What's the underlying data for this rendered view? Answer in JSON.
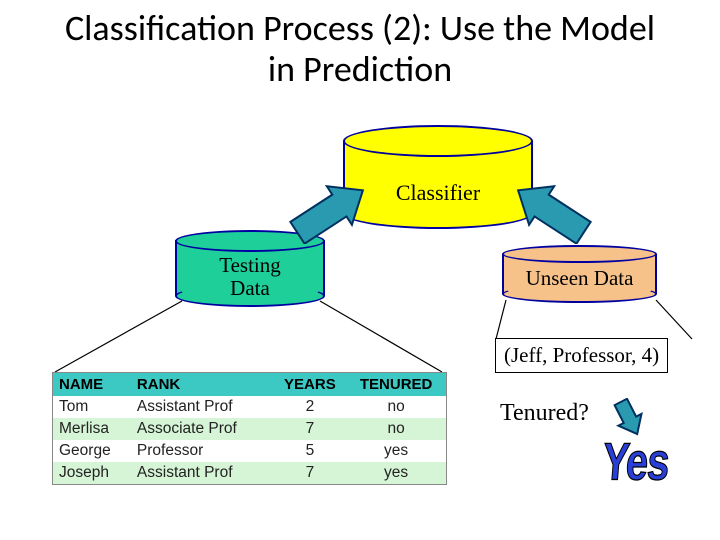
{
  "title": "Classification Process (2): Use the Model in Prediction",
  "nodes": {
    "classifier": "Classifier",
    "testing": "Testing\nData",
    "unseen": "Unseen Data"
  },
  "record": "(Jeff, Professor, 4)",
  "question": "Tenured?",
  "answer": "Yes",
  "table": {
    "headers": [
      "NAME",
      "RANK",
      "YEARS",
      "TENURED"
    ],
    "rows": [
      {
        "name": "Tom",
        "rank": "Assistant Prof",
        "years": 2,
        "tenured": "no"
      },
      {
        "name": "Merlisa",
        "rank": "Associate Prof",
        "years": 7,
        "tenured": "no"
      },
      {
        "name": "George",
        "rank": "Professor",
        "years": 5,
        "tenured": "yes"
      },
      {
        "name": "Joseph",
        "rank": "Assistant Prof",
        "years": 7,
        "tenured": "yes"
      }
    ]
  },
  "chart_data": {
    "type": "table",
    "title": "Testing Data",
    "columns": [
      "NAME",
      "RANK",
      "YEARS",
      "TENURED"
    ],
    "rows": [
      [
        "Tom",
        "Assistant Prof",
        2,
        "no"
      ],
      [
        "Merlisa",
        "Associate Prof",
        7,
        "no"
      ],
      [
        "George",
        "Professor",
        5,
        "yes"
      ],
      [
        "Joseph",
        "Assistant Prof",
        7,
        "yes"
      ]
    ]
  },
  "colors": {
    "classifier_fill": "#ffff00",
    "testing_fill": "#1fcf99",
    "unseen_fill": "#f7c28a",
    "arrow_fill": "#2a9ab0",
    "cyl_border": "#0000a0",
    "table_header": "#3dc9c3",
    "table_alt": "#d6f4d6",
    "answer_color": "#2a3fd6"
  }
}
